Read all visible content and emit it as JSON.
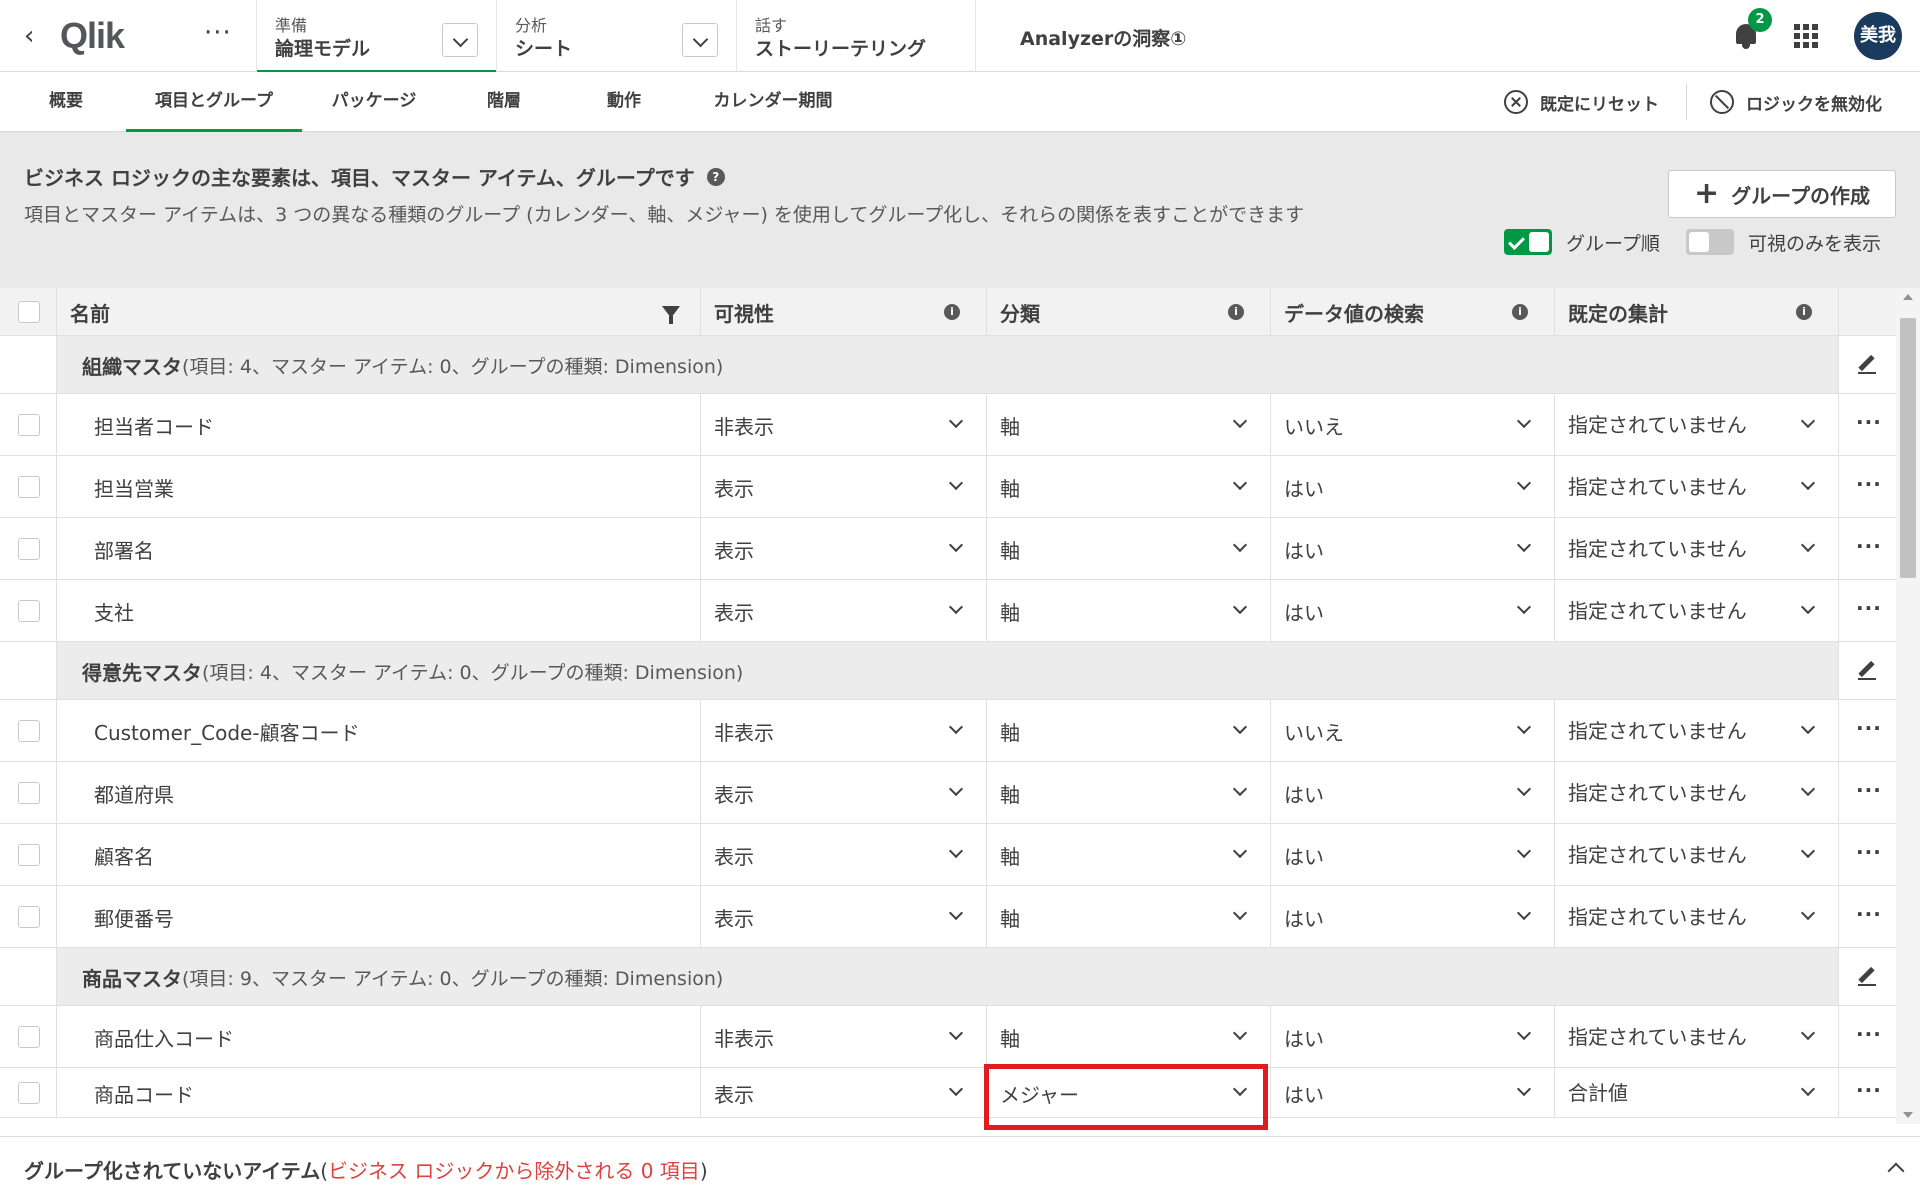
{
  "header": {
    "logo": "Qlik",
    "stages": [
      {
        "label": "準備",
        "value": "論理モデル"
      },
      {
        "label": "分析",
        "value": "シート"
      },
      {
        "label": "話す",
        "value": "ストーリーテリング"
      }
    ],
    "app_title": "Analyzerの洞察①",
    "notification_count": "2",
    "avatar_initials": "美我"
  },
  "tabs": [
    "概要",
    "項目とグループ",
    "パッケージ",
    "階層",
    "動作",
    "カレンダー期間"
  ],
  "active_tab": "項目とグループ",
  "toolbar": {
    "reset_label": "既定にリセット",
    "disable_logic_label": "ロジックを無効化"
  },
  "info": {
    "title": "ビジネス ロジックの主な要素は、項目、マスター アイテム、グループです",
    "description": "項目とマスター アイテムは、3 つの異なる種類のグループ (カレンダー、軸、メジャー) を使用してグループ化し、それらの関係を表すことができます",
    "create_group_label": "グループの作成",
    "group_order_label": "グループ順",
    "group_order_on": true,
    "visible_only_label": "可視のみを表示",
    "visible_only_on": false
  },
  "table": {
    "columns": [
      "名前",
      "可視性",
      "分類",
      "データ値の検索",
      "既定の集計"
    ],
    "groups": [
      {
        "name": "組織マスタ",
        "meta": "(項目: 4、マスター アイテム: 0、グループの種類: Dimension)",
        "rows": [
          {
            "name": "担当者コード",
            "visibility": "非表示",
            "category": "軸",
            "search": "いいえ",
            "aggregation": "指定されていません"
          },
          {
            "name": "担当営業",
            "visibility": "表示",
            "category": "軸",
            "search": "はい",
            "aggregation": "指定されていません"
          },
          {
            "name": "部署名",
            "visibility": "表示",
            "category": "軸",
            "search": "はい",
            "aggregation": "指定されていません"
          },
          {
            "name": "支社",
            "visibility": "表示",
            "category": "軸",
            "search": "はい",
            "aggregation": "指定されていません"
          }
        ]
      },
      {
        "name": "得意先マスタ",
        "meta": "(項目: 4、マスター アイテム: 0、グループの種類: Dimension)",
        "rows": [
          {
            "name": "Customer_Code-顧客コード",
            "visibility": "非表示",
            "category": "軸",
            "search": "いいえ",
            "aggregation": "指定されていません"
          },
          {
            "name": "都道府県",
            "visibility": "表示",
            "category": "軸",
            "search": "はい",
            "aggregation": "指定されていません"
          },
          {
            "name": "顧客名",
            "visibility": "表示",
            "category": "軸",
            "search": "はい",
            "aggregation": "指定されていません"
          },
          {
            "name": "郵便番号",
            "visibility": "表示",
            "category": "軸",
            "search": "はい",
            "aggregation": "指定されていません"
          }
        ]
      },
      {
        "name": "商品マスタ",
        "meta": "(項目: 9、マスター アイテム: 0、グループの種類: Dimension)",
        "rows": [
          {
            "name": "商品仕入コード",
            "visibility": "非表示",
            "category": "軸",
            "search": "はい",
            "aggregation": "指定されていません"
          },
          {
            "name": "商品コード",
            "visibility": "表示",
            "category": "メジャー",
            "search": "はい",
            "aggregation": "合計値"
          }
        ]
      }
    ]
  },
  "footer": {
    "title": "グループ化されていないアイテム",
    "note": "ビジネス ロジックから除外される 0 項目"
  },
  "colors": {
    "accent": "#009845",
    "highlight": "#e01b22",
    "footer_note": "#dc423f",
    "avatar": "#1a3a5e"
  }
}
